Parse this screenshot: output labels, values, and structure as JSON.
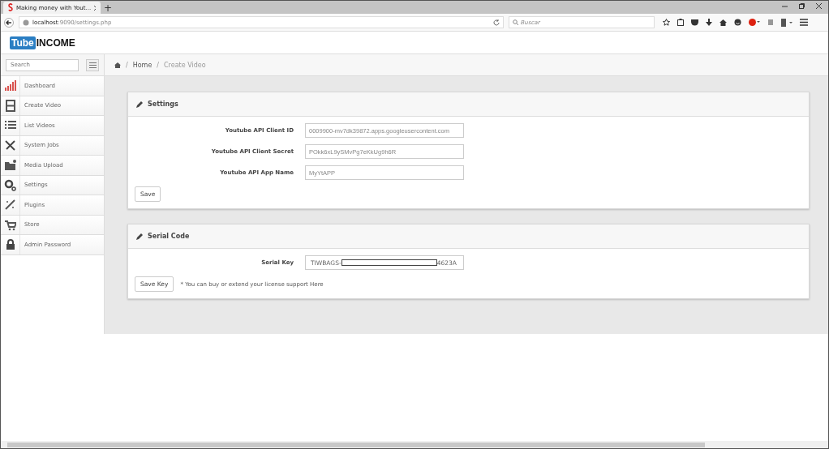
{
  "browser": {
    "tab_title": "Making money with Yout...",
    "new_tab": "+",
    "url": "**localhost**:9090/settings.php",
    "search_placeholder": "Buscar"
  },
  "logo": {
    "part1": "Tube",
    "part2": "INCOME"
  },
  "sidebar": {
    "search_placeholder": "Search",
    "items": [
      {
        "label": "Dashboard"
      },
      {
        "label": "Create Video"
      },
      {
        "label": "List Videos"
      },
      {
        "label": "System Jobs"
      },
      {
        "label": "Media Upload"
      },
      {
        "label": "Settings"
      },
      {
        "label": "Plugins"
      },
      {
        "label": "Store"
      },
      {
        "label": "Admin Password"
      }
    ]
  },
  "breadcrumb": {
    "separator": "/",
    "items": [
      "Home",
      "Create Video"
    ]
  },
  "panels": [
    {
      "title": "Settings",
      "fields": [
        {
          "label": "Youtube API Client ID",
          "value": "0009900-mv7dk39872.apps.googleusercontent.com"
        },
        {
          "label": "Youtube API Client Secret",
          "value": "POkk6xL9ySMvPg7eKkUg9h6R"
        },
        {
          "label": "Youtube API App Name",
          "value": "MyYtAPP"
        }
      ],
      "button": "Save"
    },
    {
      "title": "Serial Code",
      "fields": [
        {
          "label": "Serial Key",
          "value_start": "TIWBAGS-",
          "value_end": "4623A"
        }
      ],
      "button": "Save Key",
      "note": "* You can buy or extend your license support Here"
    }
  ]
}
